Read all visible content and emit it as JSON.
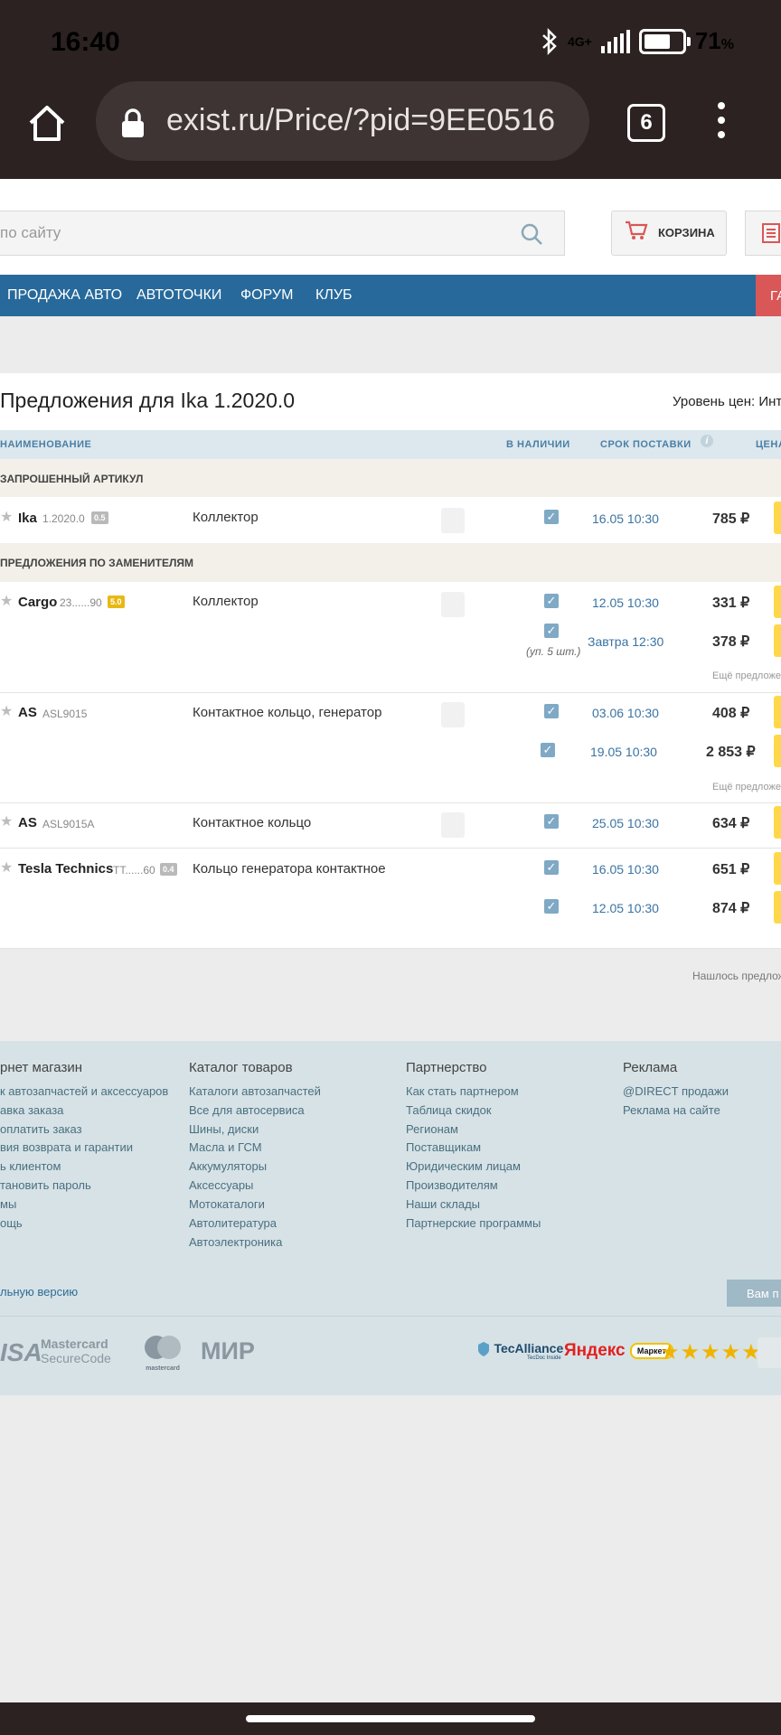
{
  "status_bar": {
    "time": "16:40",
    "network": "4G+",
    "battery": "71",
    "battery_unit": "%",
    "battery_level": 0.71
  },
  "browser": {
    "url": "exist.ru/Price/?pid=9EE0516",
    "tab_count": "6"
  },
  "header": {
    "search_placeholder": "по сайту",
    "cart_label": "КОРЗИНА"
  },
  "nav": {
    "items": [
      "ПРОДАЖА АВТО",
      "АВТОТОЧКИ",
      "ФОРУМ",
      "КЛУБ"
    ],
    "cut_item": "ГА"
  },
  "offers": {
    "title": "Предложения для  Ika 1.2020.0",
    "price_level": "Уровень цен: Инте",
    "columns": {
      "name": "НАИМЕНОВАНИЕ",
      "stock": "В НАЛИЧИИ",
      "delivery": "СРОК ПОСТАВКИ",
      "price": "ЦЕНА"
    },
    "section_requested": "ЗАПРОШЕННЫЙ АРТИКУЛ",
    "section_analogs": "ПРЕДЛОЖЕНИЯ ПО ЗАМЕНИТЕЛЯМ",
    "rows": [
      {
        "brand": "Ika",
        "article": "1.2020.0",
        "badge": "0.5",
        "name": "Коллектор",
        "offers": [
          {
            "date": "16.05 10:30",
            "price": "785 ₽"
          }
        ]
      },
      {
        "brand": "Cargo",
        "article": "23......90",
        "badge": "5.0",
        "name": "Коллектор",
        "offers": [
          {
            "date": "12.05 10:30",
            "price": "331 ₽"
          },
          {
            "date": "Завтра 12:30",
            "price": "378 ₽",
            "pack": "(уп. 5 шт.)"
          }
        ],
        "more": "Ещё предложе"
      },
      {
        "brand": "AS",
        "article": "ASL9015",
        "name": "Контактное кольцо, генератор",
        "offers": [
          {
            "date": "03.06 10:30",
            "price": "408 ₽"
          },
          {
            "date": "19.05 10:30",
            "price": "2 853 ₽"
          }
        ],
        "more": "Ещё предложе"
      },
      {
        "brand": "AS",
        "article": "ASL9015A",
        "name": "Контактное кольцо",
        "offers": [
          {
            "date": "25.05 10:30",
            "price": "634 ₽"
          }
        ]
      },
      {
        "brand": "Tesla Technics",
        "article": "TT......60",
        "badge": "0.4",
        "name": "Кольцо генератора контактное",
        "offers": [
          {
            "date": "16.05 10:30",
            "price": "651 ₽"
          },
          {
            "date": "12.05 10:30",
            "price": "874 ₽"
          }
        ]
      }
    ],
    "found_text": "Нашлось предлож"
  },
  "footer": {
    "columns": [
      {
        "title": "рнет магазин",
        "links": [
          "к автозапчастей и аксессуаров",
          "авка заказа",
          "оплатить заказ",
          "вия возврата и гарантии",
          "ь клиентом",
          "тановить пароль",
          "мы",
          "ощь"
        ]
      },
      {
        "title": "Каталог товаров",
        "links": [
          "Каталоги автозапчастей",
          "Все для автосервиса",
          "Шины, диски",
          "Масла и ГСМ",
          "Аккумуляторы",
          "Аксессуары",
          "Мотокаталоги",
          "Автолитература",
          "Автоэлектроника"
        ]
      },
      {
        "title": "Партнерство",
        "links": [
          "Как стать партнером",
          "Таблица скидок",
          "Регионам",
          "Поставщикам",
          "Юридическим лицам",
          "Производителям",
          "Наши склады",
          "Партнерские программы"
        ]
      },
      {
        "title": "Реклама",
        "links": [
          "@DIRECT продажи",
          "Реклама на сайте"
        ]
      }
    ],
    "full_version": "льную версию",
    "feedback": "Вам п",
    "logos": {
      "visa": "ISA",
      "mastercard_securecode_1": "Mastercard",
      "mastercard_securecode_2": "SecureCode",
      "mastercard": "mastercard",
      "mir": "МИР",
      "tecalliance": "TecAlliance",
      "tecalliance_sub": "TecDoc Inside",
      "yandex": "Яндекс",
      "market": "Маркет",
      "stars": "★★★★★"
    }
  }
}
